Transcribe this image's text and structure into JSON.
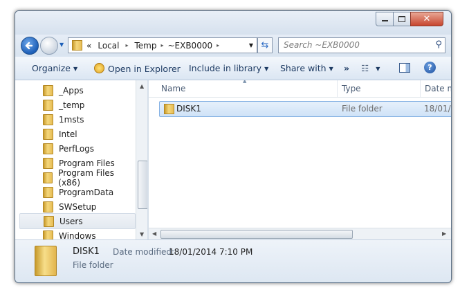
{
  "address": {
    "overflow": "«",
    "crumbs": [
      "Local",
      "Temp",
      "~EXB0000"
    ],
    "separator": "▸"
  },
  "search": {
    "placeholder": "Search ~EXB0000"
  },
  "toolbar": {
    "organize": "Organize",
    "open_in_explorer": "Open in Explorer",
    "include_in_library": "Include in library",
    "share_with": "Share with",
    "more": "»"
  },
  "navpane": {
    "items": [
      "_Apps",
      "_temp",
      "1msts",
      "Intel",
      "PerfLogs",
      "Program Files",
      "Program Files (x86)",
      "ProgramData",
      "SWSetup",
      "Users",
      "Windows"
    ],
    "selected": "Users"
  },
  "columns": {
    "name": "Name",
    "type": "Type",
    "date": "Date m"
  },
  "files": [
    {
      "name": "DISK1",
      "type": "File folder",
      "date": "18/01/"
    }
  ],
  "details": {
    "name": "DISK1",
    "date_label": "Date modified:",
    "date_value": "18/01/2014 7:10 PM",
    "type": "File folder"
  },
  "icons": [
    "back-icon",
    "forward-icon",
    "folder-icon",
    "refresh-icon",
    "search-icon",
    "help-icon",
    "views-icon",
    "preview-pane-icon"
  ],
  "colors": {
    "accent": "#1d5fb8",
    "selection": "#cfe2f7",
    "chrome": "#dbe6f2"
  }
}
